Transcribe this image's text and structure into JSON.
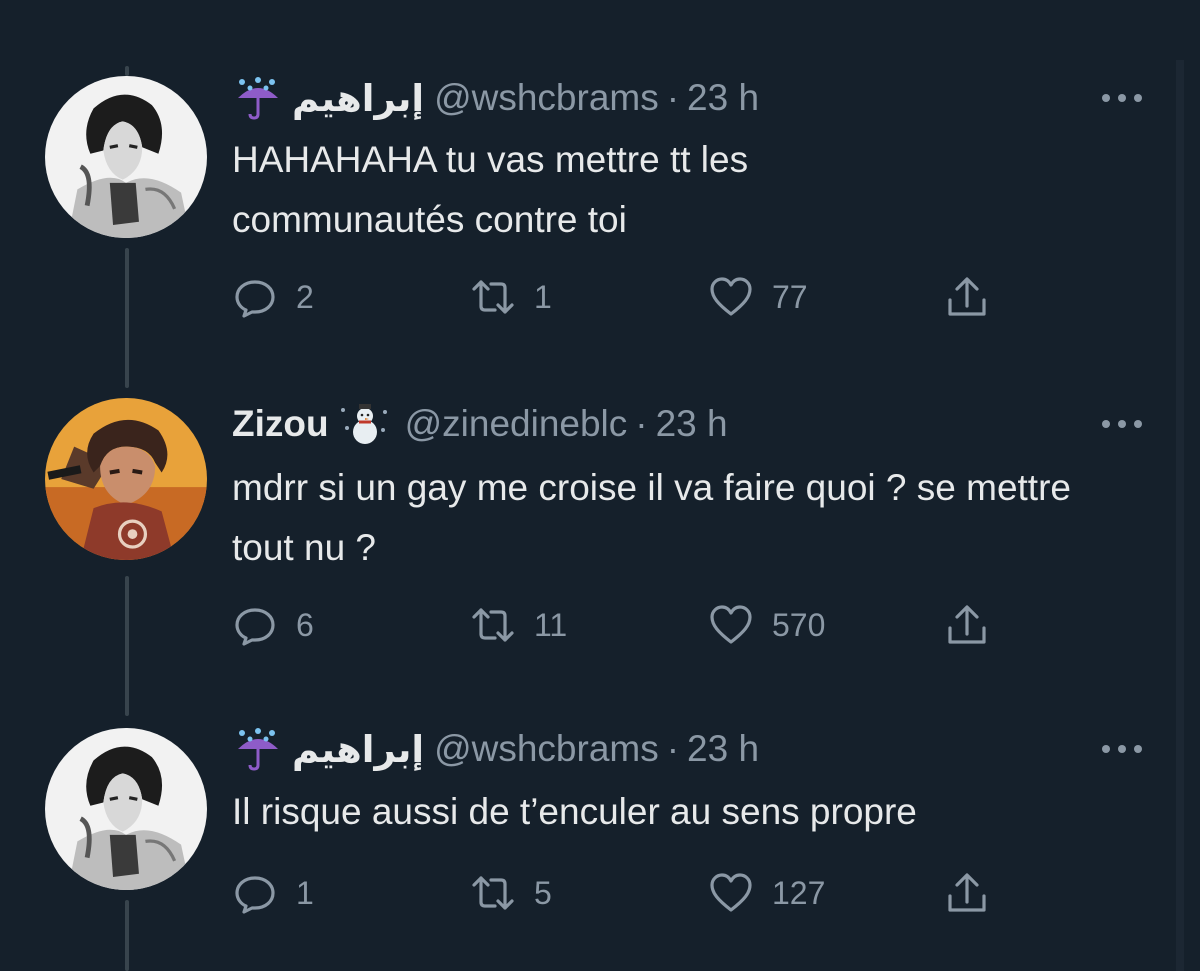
{
  "tweets": [
    {
      "name": "إبراهيم",
      "name_emoji": "umbrella-with-rain-emoji",
      "handle": "@wshcbrams",
      "separator": "·",
      "time": "23 h",
      "text": "HAHAHAHA tu vas mettre tt les communautés contre toi",
      "replies": "2",
      "retweets": "1",
      "likes": "77"
    },
    {
      "name": "Zizou",
      "name_emoji": "snowman-emoji",
      "handle": "@zinedineblc",
      "separator": "·",
      "time": "23 h",
      "text": "mdrr si un gay me croise il va faire quoi ? se mettre tout nu ?",
      "replies": "6",
      "retweets": "11",
      "likes": "570"
    },
    {
      "name": "إبراهيم",
      "name_emoji": "umbrella-with-rain-emoji",
      "handle": "@wshcbrams",
      "separator": "·",
      "time": "23 h",
      "text": "Il risque aussi de t’enculer au sens propre",
      "replies": "1",
      "retweets": "5",
      "likes": "127"
    }
  ],
  "colors": {
    "background": "#15202b",
    "text_primary": "#e7e9ea",
    "text_secondary": "#8b98a5",
    "thread_line": "#38444d"
  },
  "icons": [
    "reply-icon",
    "retweet-icon",
    "like-icon",
    "share-icon",
    "more-icon"
  ]
}
